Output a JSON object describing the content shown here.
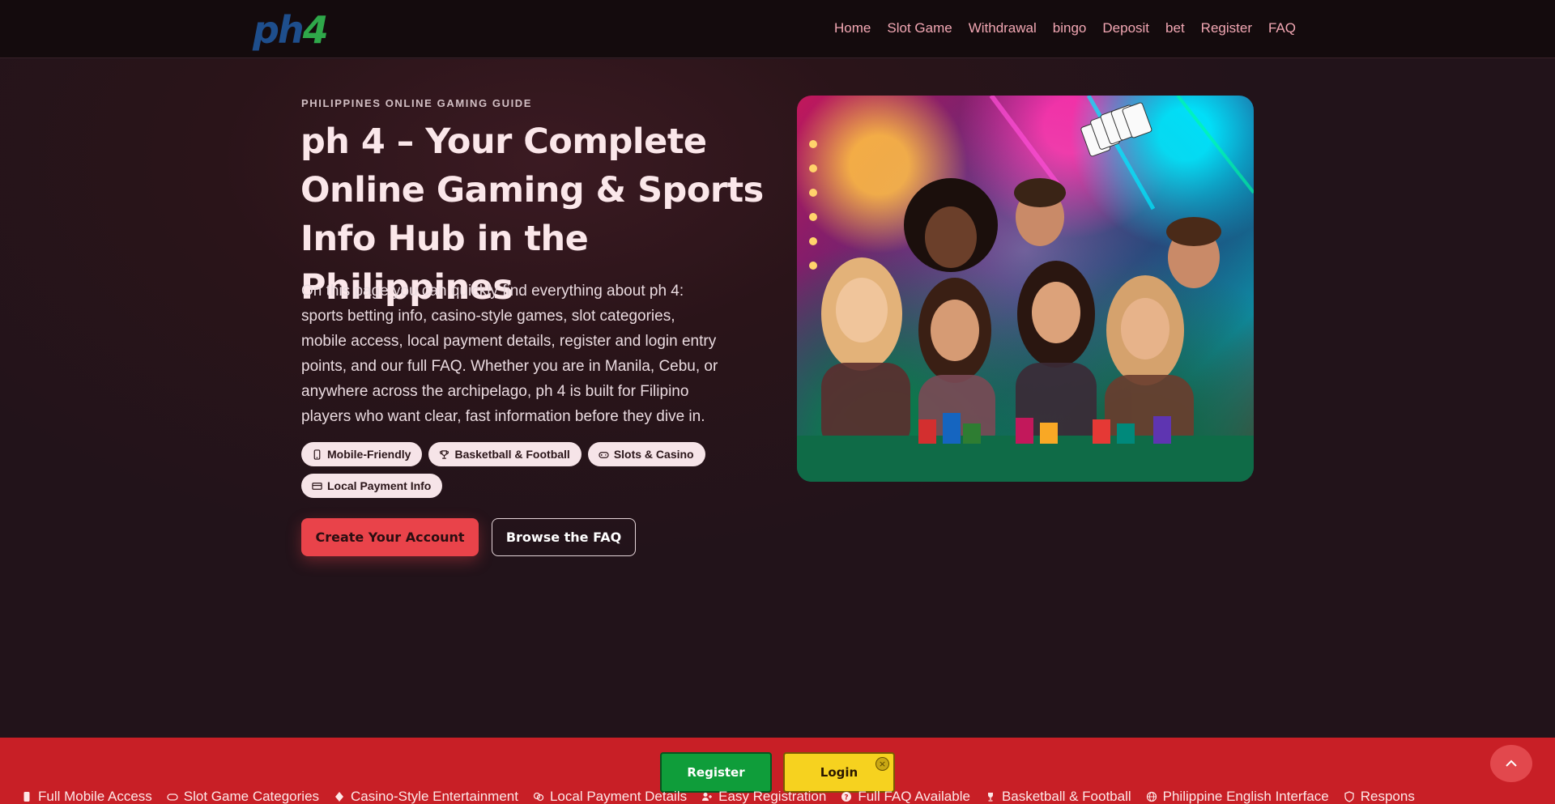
{
  "header": {
    "logo": {
      "part1": "ph",
      "part2": "4"
    },
    "nav": [
      "Home",
      "Slot Game",
      "Withdrawal",
      "bingo",
      "Deposit",
      "bet",
      "Register",
      "FAQ"
    ]
  },
  "hero": {
    "eyebrow": "PHILIPPINES ONLINE GAMING GUIDE",
    "title": "ph 4 – Your Complete Online Gaming & Sports Info Hub in the Philippines",
    "lead": "On this page you can quickly find everything about ph 4: sports betting info, casino-style games, slot categories, mobile access, local payment details, register and login entry points, and our full FAQ. Whether you are in Manila, Cebu, or anywhere across the archipelago, ph 4 is built for Filipino players who want clear, fast information before they dive in.",
    "chips": [
      {
        "icon": "phone-icon",
        "label": "Mobile-Friendly"
      },
      {
        "icon": "trophy-icon",
        "label": "Basketball & Football"
      },
      {
        "icon": "gamepad-icon",
        "label": "Slots & Casino"
      },
      {
        "icon": "card-icon",
        "label": "Local Payment Info"
      }
    ],
    "cta_primary": "Create Your Account",
    "cta_secondary": "Browse the FAQ",
    "image_alt": "Group of excited friends celebrating at a casino table with chips and playing cards"
  },
  "ticker": [
    {
      "icon": "phone-icon",
      "label": "Full Mobile Access"
    },
    {
      "icon": "gamepad-icon",
      "label": "Slot Game Categories"
    },
    {
      "icon": "diamond-icon",
      "label": "Casino-Style Entertainment"
    },
    {
      "icon": "coins-icon",
      "label": "Local Payment Details"
    },
    {
      "icon": "user-plus-icon",
      "label": "Easy Registration"
    },
    {
      "icon": "question-icon",
      "label": "Full FAQ Available"
    },
    {
      "icon": "trophy-icon",
      "label": "Basketball & Football"
    },
    {
      "icon": "globe-icon",
      "label": "Philippine English Interface"
    },
    {
      "icon": "shield-icon",
      "label": "Respons"
    }
  ],
  "sticky": {
    "register": "Register",
    "login": "Login",
    "close": "×"
  },
  "colors": {
    "accent": "#e9434a",
    "bar": "#c81f26",
    "register": "#0f9d3a",
    "login": "#f6d21f"
  }
}
